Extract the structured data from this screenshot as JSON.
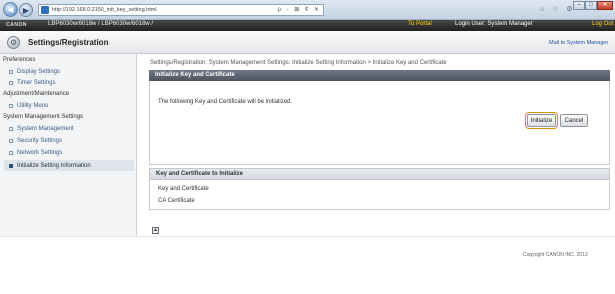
{
  "browser": {
    "url": "http://192.168.0.215/i_init_key_setting.html",
    "address_tools": "ρ - ⊠ ¢ ✕",
    "right_tools": "⌂ ☆ ⚙",
    "win_minimize": "–",
    "win_maximize": "□",
    "win_close": "✕"
  },
  "device_bar": {
    "brand": "CANON",
    "device_name": "LBP6030w/6018w / LBP6030w/6018w /",
    "portal_link": "To Portal",
    "login_user": "Login User: System Manager",
    "logout": "Log Out"
  },
  "header": {
    "title": "Settings/Registration",
    "mail_link": "Mail to System Manager"
  },
  "sidebar": {
    "preferences": "Preferences",
    "display_settings": "Display Settings",
    "timer_settings": "Timer Settings",
    "adjustment": "Adjustment/Maintenance",
    "utility_menu": "Utility Menu",
    "system_management_settings": "System Management Settings",
    "system_management": "System Management",
    "security_settings": "Security Settings",
    "network_settings": "Network Settings",
    "initialize_setting_information": "Initialize Setting Information"
  },
  "main": {
    "breadcrumb": "Settings/Registration: System Management Settings: Initialize Setting Information > Initialize Key and Certificate",
    "panel_title": "Initialize Key and Certificate",
    "message": "The following Key and Certificate will be initialized.",
    "initialize_button": "Initialize",
    "cancel_button": "Cancel",
    "list_title": "Key and Certificate to Initialize",
    "items": [
      "Key and Certificate",
      "CA Certificate"
    ],
    "top_icon": "▲"
  },
  "footer": {
    "copyright": "Copyright CANON INC. 2013"
  }
}
